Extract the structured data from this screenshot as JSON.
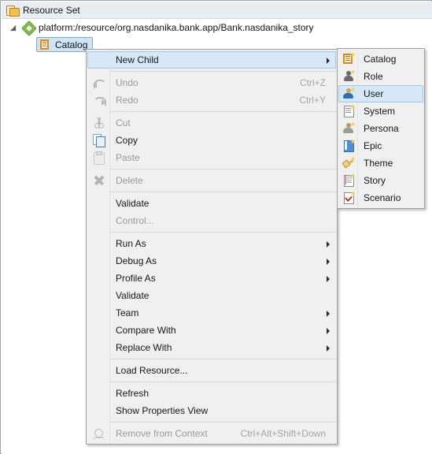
{
  "window": {
    "title": "Resource Set"
  },
  "tree": {
    "root": {
      "label": "Resource Set",
      "icon": "resource-set-icon"
    },
    "resource": {
      "label": "platform:/resource/org.nasdanika.bank.app/Bank.nasdanika_story",
      "icon": "model-resource-icon",
      "expanded": true
    },
    "child": {
      "label": "Catalog",
      "icon": "catalog-icon",
      "selected": true
    }
  },
  "colors": {
    "selection_fill": "#cfe4f7",
    "selection_border": "#7da7d0",
    "menu_background": "#f0f0f0",
    "menu_highlight": "#d6e8f7",
    "menu_highlight_border": "#a3c6e4",
    "title_bar": "#e9eef3"
  },
  "context_menu": {
    "items": [
      {
        "id": "new-child",
        "label": "New Child",
        "accel": "",
        "icon": "",
        "submenu": true,
        "disabled": false,
        "selected": true,
        "separator_after": true
      },
      {
        "id": "undo",
        "label": "Undo",
        "accel": "Ctrl+Z",
        "icon": "undo-icon",
        "submenu": false,
        "disabled": true,
        "selected": false,
        "separator_after": false
      },
      {
        "id": "redo",
        "label": "Redo",
        "accel": "Ctrl+Y",
        "icon": "redo-icon",
        "submenu": false,
        "disabled": true,
        "selected": false,
        "separator_after": true
      },
      {
        "id": "cut",
        "label": "Cut",
        "accel": "",
        "icon": "cut-icon",
        "submenu": false,
        "disabled": true,
        "selected": false,
        "separator_after": false
      },
      {
        "id": "copy",
        "label": "Copy",
        "accel": "",
        "icon": "copy-icon",
        "submenu": false,
        "disabled": false,
        "selected": false,
        "separator_after": false
      },
      {
        "id": "paste",
        "label": "Paste",
        "accel": "",
        "icon": "paste-icon",
        "submenu": false,
        "disabled": true,
        "selected": false,
        "separator_after": true
      },
      {
        "id": "delete",
        "label": "Delete",
        "accel": "",
        "icon": "delete-icon",
        "submenu": false,
        "disabled": true,
        "selected": false,
        "separator_after": true
      },
      {
        "id": "validate-1",
        "label": "Validate",
        "accel": "",
        "icon": "",
        "submenu": false,
        "disabled": false,
        "selected": false,
        "separator_after": false
      },
      {
        "id": "control",
        "label": "Control...",
        "accel": "",
        "icon": "",
        "submenu": false,
        "disabled": true,
        "selected": false,
        "separator_after": true
      },
      {
        "id": "run-as",
        "label": "Run As",
        "accel": "",
        "icon": "",
        "submenu": true,
        "disabled": false,
        "selected": false,
        "separator_after": false
      },
      {
        "id": "debug-as",
        "label": "Debug As",
        "accel": "",
        "icon": "",
        "submenu": true,
        "disabled": false,
        "selected": false,
        "separator_after": false
      },
      {
        "id": "profile-as",
        "label": "Profile As",
        "accel": "",
        "icon": "",
        "submenu": true,
        "disabled": false,
        "selected": false,
        "separator_after": false
      },
      {
        "id": "validate-2",
        "label": "Validate",
        "accel": "",
        "icon": "",
        "submenu": false,
        "disabled": false,
        "selected": false,
        "separator_after": false
      },
      {
        "id": "team",
        "label": "Team",
        "accel": "",
        "icon": "",
        "submenu": true,
        "disabled": false,
        "selected": false,
        "separator_after": false
      },
      {
        "id": "compare-with",
        "label": "Compare With",
        "accel": "",
        "icon": "",
        "submenu": true,
        "disabled": false,
        "selected": false,
        "separator_after": false
      },
      {
        "id": "replace-with",
        "label": "Replace With",
        "accel": "",
        "icon": "",
        "submenu": true,
        "disabled": false,
        "selected": false,
        "separator_after": true
      },
      {
        "id": "load-resource",
        "label": "Load Resource...",
        "accel": "",
        "icon": "",
        "submenu": false,
        "disabled": false,
        "selected": false,
        "separator_after": true
      },
      {
        "id": "refresh",
        "label": "Refresh",
        "accel": "",
        "icon": "",
        "submenu": false,
        "disabled": false,
        "selected": false,
        "separator_after": false
      },
      {
        "id": "show-properties-view",
        "label": "Show Properties View",
        "accel": "",
        "icon": "",
        "submenu": false,
        "disabled": false,
        "selected": false,
        "separator_after": true
      },
      {
        "id": "remove-from-context",
        "label": "Remove from Context",
        "accel": "Ctrl+Alt+Shift+Down",
        "icon": "remove-icon",
        "submenu": false,
        "disabled": true,
        "selected": false,
        "separator_after": false
      }
    ]
  },
  "submenu": {
    "parent": "New Child",
    "items": [
      {
        "id": "catalog",
        "label": "Catalog",
        "icon": "catalog-new-icon",
        "selected": false
      },
      {
        "id": "role",
        "label": "Role",
        "icon": "role-new-icon",
        "selected": false
      },
      {
        "id": "user",
        "label": "User",
        "icon": "user-new-icon",
        "selected": true
      },
      {
        "id": "system",
        "label": "System",
        "icon": "system-new-icon",
        "selected": false
      },
      {
        "id": "persona",
        "label": "Persona",
        "icon": "persona-new-icon",
        "selected": false
      },
      {
        "id": "epic",
        "label": "Epic",
        "icon": "epic-new-icon",
        "selected": false
      },
      {
        "id": "theme",
        "label": "Theme",
        "icon": "theme-new-icon",
        "selected": false
      },
      {
        "id": "story",
        "label": "Story",
        "icon": "story-new-icon",
        "selected": false
      },
      {
        "id": "scenario",
        "label": "Scenario",
        "icon": "scenario-new-icon",
        "selected": false
      }
    ]
  }
}
